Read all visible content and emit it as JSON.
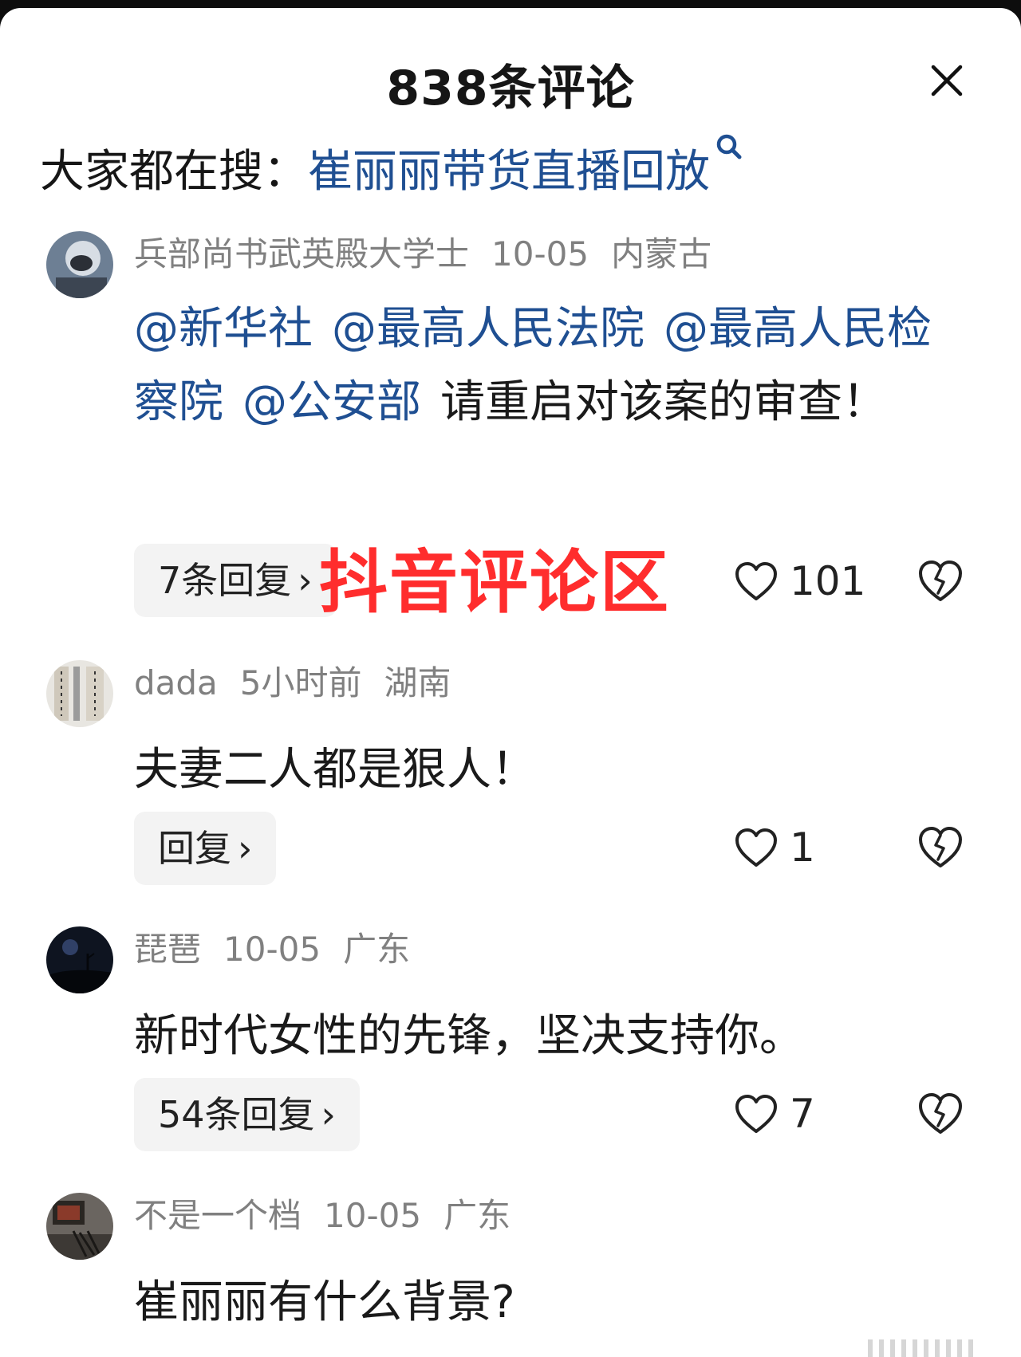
{
  "header": {
    "title": "838条评论"
  },
  "search": {
    "prefix": "大家都在搜：",
    "term": "崔丽丽带货直播回放"
  },
  "watermark": "抖音评论区",
  "comments": [
    {
      "username": "兵部尚书武英殿大学士",
      "time": "10-05",
      "location": "内蒙古",
      "mentions": [
        "@新华社",
        "@最高人民法院",
        "@最高人民检察院",
        "@公安部"
      ],
      "text": "请重启对该案的审查！",
      "reply_label": "7条回复",
      "likes": "101"
    },
    {
      "username": "dada",
      "time": "5小时前",
      "location": "湖南",
      "text": "夫妻二人都是狠人！",
      "reply_label": "回复",
      "likes": "1"
    },
    {
      "username": "琵琶",
      "time": "10-05",
      "location": "广东",
      "text": "新时代女性的先锋，坚决支持你。",
      "reply_label": "54条回复",
      "likes": "7"
    },
    {
      "username": "不是一个档",
      "time": "10-05",
      "location": "广东",
      "text": "崔丽丽有什么背景?"
    }
  ]
}
